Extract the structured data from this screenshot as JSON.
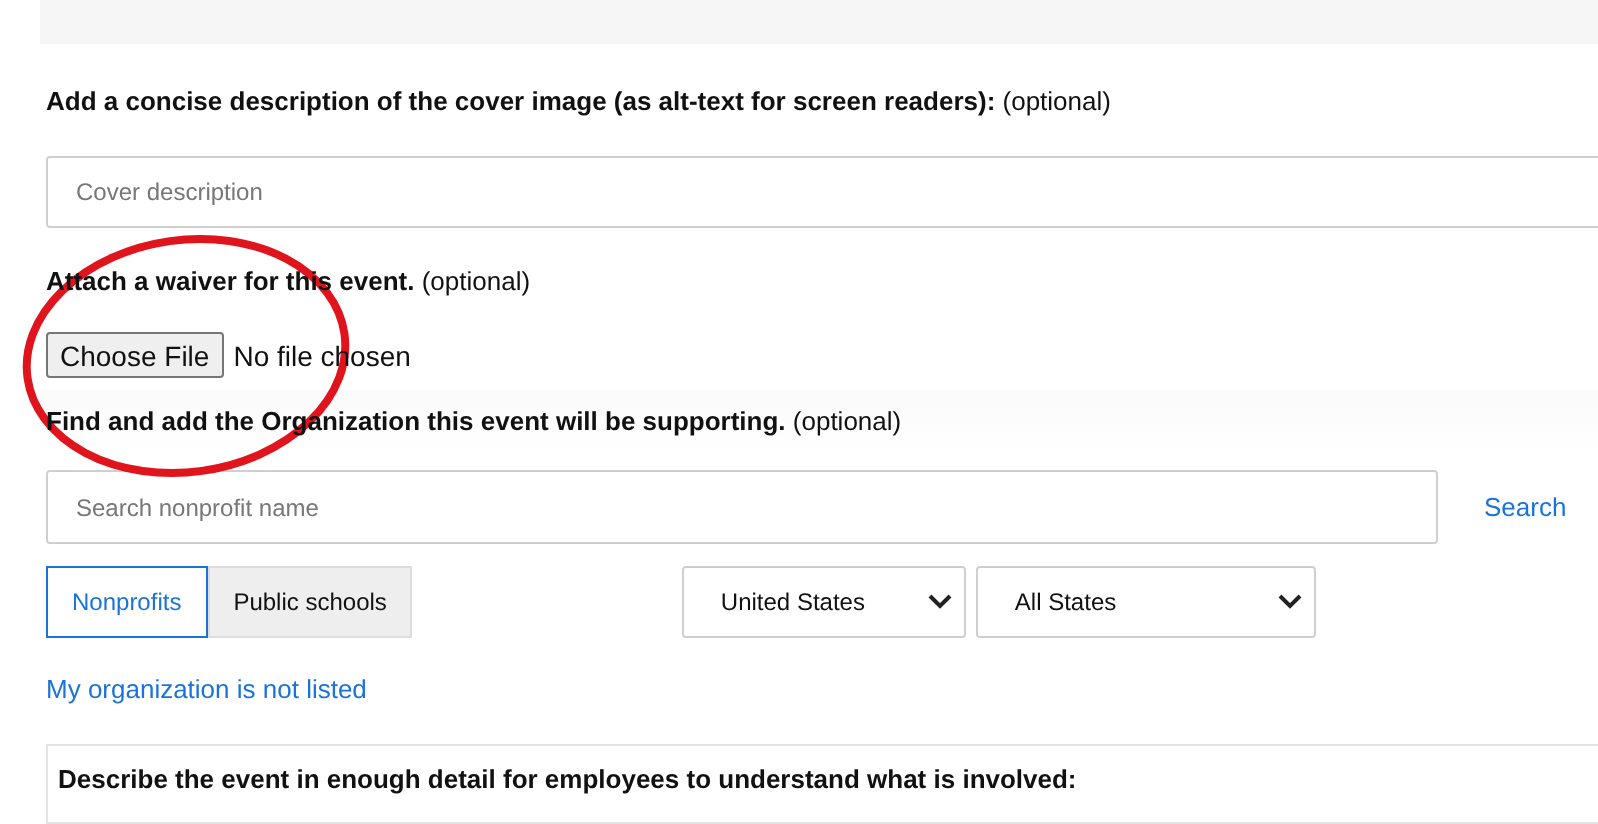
{
  "cover_description": {
    "label": "**Add a concise description of the cover image (as alt-text for screen readers):** (optional)",
    "placeholder": "Cover description"
  },
  "waiver": {
    "label": "**Attach a waiver for this event.** (optional)",
    "button": "Choose File",
    "status": "No file chosen"
  },
  "organization": {
    "label": "**Find and add the Organization this event will be supporting.** (optional)",
    "placeholder": "Search nonprofit name",
    "search_button": "Search",
    "tabs": [
      {
        "label": "Nonprofits",
        "selected": true
      },
      {
        "label": "Public schools",
        "selected": false
      }
    ],
    "country": "United States",
    "state": "All States",
    "not_listed_link": "My organization is not listed"
  },
  "details": {
    "label": "Describe the event in enough detail for employees to understand what is involved:"
  }
}
